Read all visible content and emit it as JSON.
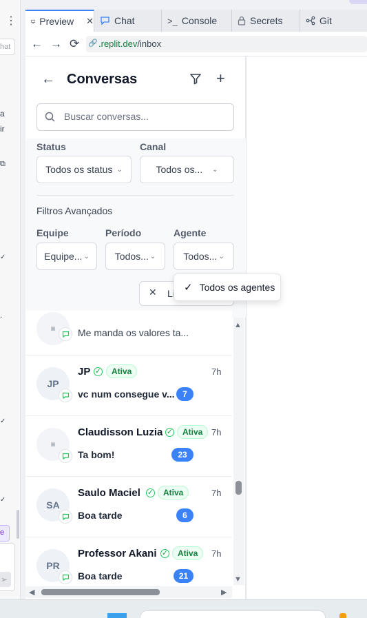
{
  "browser": {
    "tabs": [
      {
        "label": "Preview",
        "icon": "monitor-icon",
        "active": true
      },
      {
        "label": "Chat",
        "icon": "chat-bubble-icon",
        "active": false
      },
      {
        "label": "Console",
        "icon": "terminal-icon",
        "active": false
      },
      {
        "label": "Secrets",
        "icon": "lock-icon",
        "active": false
      },
      {
        "label": "Git",
        "icon": "git-branch-icon",
        "active": false
      }
    ],
    "url_domain": ".replit.dev",
    "url_path": "/inbox"
  },
  "left_panel": {
    "fragments": [
      "hat",
      "a",
      "ir",
      "e"
    ]
  },
  "inbox": {
    "title": "Conversas",
    "search_placeholder": "Buscar conversas...",
    "filters": {
      "status_label": "Status",
      "status_value": "Todos os status",
      "channel_label": "Canal",
      "channel_value": "Todos os...",
      "advanced_title": "Filtros Avançados",
      "team_label": "Equipe",
      "team_value": "Equipe...",
      "period_label": "Período",
      "period_value": "Todos...",
      "agent_label": "Agente",
      "agent_value": "Todos...",
      "clear_label": "Li"
    },
    "agent_dropdown": {
      "selected_option": "Todos os agentes"
    },
    "conversations": [
      {
        "name": "",
        "avatar": "image",
        "message": "Me manda os valores ta...",
        "status": "",
        "time": "",
        "unread": ""
      },
      {
        "name": "JP",
        "avatar": "JP",
        "message": "vc num consegue v...",
        "status": "Ativa",
        "time": "7h",
        "unread": "7"
      },
      {
        "name": "Claudisson Luzia",
        "avatar": "image",
        "message": "Ta bom!",
        "status": "Ativa",
        "time": "7h",
        "unread": "23"
      },
      {
        "name": "Saulo Maciel",
        "avatar": "SA",
        "message": "Boa tarde",
        "status": "Ativa",
        "time": "7h",
        "unread": "6"
      },
      {
        "name": "Professor Akani",
        "avatar": "PR",
        "message": "Boa tarde",
        "status": "Ativa",
        "time": "7h",
        "unread": "21"
      }
    ]
  },
  "colors": {
    "accent": "#3b82f6",
    "whatsapp_green": "#22c55e",
    "active_pill": "#ecfdf3"
  }
}
